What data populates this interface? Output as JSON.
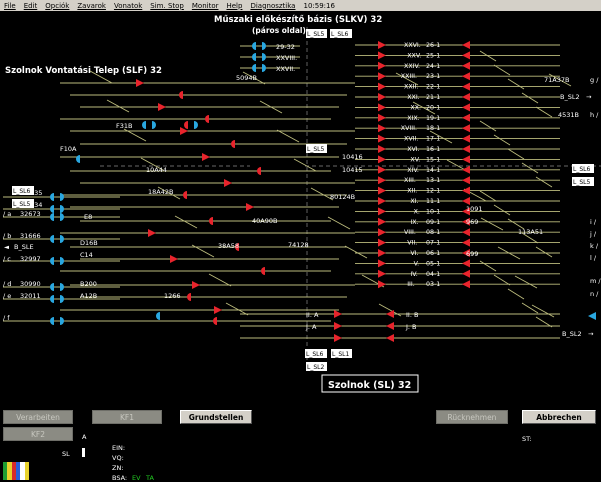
{
  "menu": {
    "items": [
      "File",
      "Edit",
      "Opciók",
      "Zavarok",
      "Vonatok",
      "Sim. Stop",
      "Monitor",
      "Help",
      "Diagnosztika"
    ],
    "time": "10:59:16"
  },
  "header": {
    "title_line1": "Műszaki előkészítő bázis  (SLKV)  32",
    "title_line2": "(páros oldal)",
    "left_title": "Szolnok Vontatási Telep  (SLF)  32",
    "station_title": "Szolnok  (SL)  32"
  },
  "signals": {
    "top_list": [
      "29-32",
      "XXVIII.",
      "XXVII."
    ],
    "right_column": [
      "XXVI.",
      "XXV.",
      "XXIV.",
      "XXIII.",
      "XXII.",
      "XXI.",
      "XX.",
      "XIX.",
      "XVIII.",
      "XVII.",
      "XVI.",
      "XV.",
      "XIV.",
      "XIII.",
      "XII.",
      "XI.",
      "X.",
      "IX.",
      "VIII.",
      "VII.",
      "VI.",
      "V.",
      "IV.",
      "III."
    ],
    "right_numbers": [
      "26-1",
      "25-1",
      "24-1",
      "23-1",
      "22-1",
      "21-1",
      "20-1",
      "19-1",
      "18-1",
      "17-1",
      "16-1",
      "15-1",
      "14-1",
      "13-1",
      "12-1",
      "11-1",
      "10-1",
      "09-1",
      "08-1",
      "07-1",
      "06-1",
      "05-1",
      "04-1",
      "03-1"
    ],
    "misc": [
      "5094B",
      "F31B",
      "F10A",
      "10A44",
      "18A42B",
      "E8",
      "D16B",
      "C14",
      "B200",
      "A12B",
      "1266",
      "38A58",
      "40A90B",
      "74128",
      "80124B",
      "10416",
      "10415",
      "1091",
      "969",
      "699",
      "113A51",
      "71A37B",
      "4531B",
      "035",
      "034",
      "II. A",
      "J. A",
      "II. B",
      "J. B"
    ],
    "left_labels": [
      "/ a",
      "/ b",
      "/ c",
      "/ d",
      "/ e",
      "/ f"
    ],
    "left_numbers": [
      "32673",
      "31666",
      "32997",
      "30990",
      "32011"
    ],
    "right_labels": [
      "g /",
      "h /",
      "i /",
      "j /",
      "k /",
      "l /",
      "m /",
      "n /"
    ],
    "sl_boxes": [
      "L_SL5",
      "L_SL6",
      "L_SL5",
      "L_SL6",
      "L_SL5",
      "L_SL6",
      "L_SL5",
      "L_SL6",
      "L_SL1",
      "L_SL2"
    ],
    "bse_left": "B_SLE",
    "bsl2_top": "B_SL2",
    "bsl2_bottom": "B_SL2",
    "sl_small": "SL",
    "a_small": "A"
  },
  "buttons": {
    "verarbeiten": "Verarbeiten",
    "kf1": "KF1",
    "grundstellen": "Grundstellen",
    "rucknehmen": "Rücknehmen",
    "abbrechen": "Abbrechen",
    "kf2": "KF2"
  },
  "status": {
    "ein": "EIN:",
    "vq": "VQ:",
    "zn": "ZN:",
    "bsa": "BSA:",
    "ev": "EV",
    "ta": "TA",
    "st": "ST:"
  },
  "colors": {
    "background": "#000000",
    "track": "#bdbd7e",
    "signal_red": "#e8242c",
    "signal_cyan": "#29a7e0",
    "text": "#ffffff",
    "green_text": "#22cc22"
  }
}
